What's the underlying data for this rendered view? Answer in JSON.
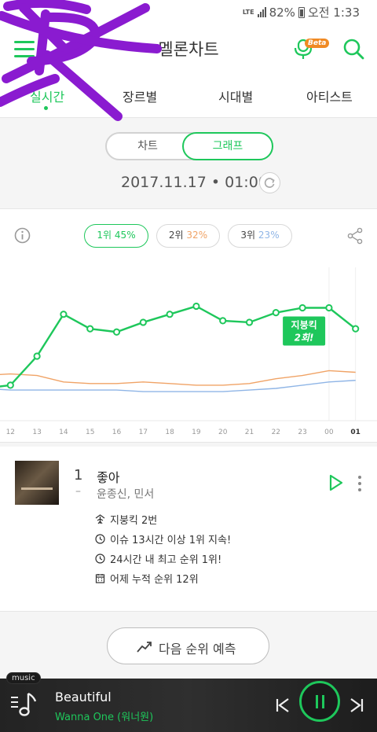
{
  "status_bar": {
    "network": "LTE",
    "battery": "82%",
    "time": "오전 1:33"
  },
  "header": {
    "title": "멜론차트",
    "beta_badge": "Beta"
  },
  "tabs": [
    {
      "label": "실시간",
      "active": true
    },
    {
      "label": "장르별",
      "active": false
    },
    {
      "label": "시대별",
      "active": false
    },
    {
      "label": "아티스트",
      "active": false
    }
  ],
  "view_toggle": {
    "chart_label": "차트",
    "graph_label": "그래프",
    "selected": "그래프"
  },
  "datetime": {
    "date": "2017.11.17",
    "separator": "•",
    "time": "01:00"
  },
  "legend": [
    {
      "rank": "1위",
      "pct": "45%",
      "color": "#1ec75b"
    },
    {
      "rank": "2위",
      "pct": "32%",
      "color": "#f0a366"
    },
    {
      "rank": "3위",
      "pct": "23%",
      "color": "#8fb5e6"
    }
  ],
  "chart_data": {
    "type": "line",
    "x": [
      "12",
      "13",
      "14",
      "15",
      "16",
      "17",
      "18",
      "19",
      "20",
      "21",
      "22",
      "23",
      "00",
      "01"
    ],
    "series": [
      {
        "values": [
          20,
          22,
          40,
          66,
          57,
          55,
          61,
          66,
          71,
          62,
          61,
          67,
          70,
          70,
          57
        ],
        "color": "#1ec75b"
      },
      {
        "values": [
          28,
          29,
          28,
          24,
          23,
          23,
          24,
          23,
          22,
          22,
          23,
          26,
          28,
          31,
          30
        ],
        "color": "#f0a366"
      },
      {
        "values": [
          20,
          19,
          19,
          19,
          19,
          19,
          18,
          18,
          18,
          18,
          19,
          20,
          22,
          24,
          25
        ],
        "color": "#8fb5e6"
      }
    ],
    "annotation": {
      "line1": "지붕킥",
      "line2": "2회!"
    },
    "ylim": [
      0,
      100
    ]
  },
  "song": {
    "rank": "1",
    "change": "–",
    "title": "좋아",
    "artist": "윤종신, 민서",
    "info": [
      {
        "icon": "rooftop-kick-icon",
        "text": "지붕킥 2번"
      },
      {
        "icon": "streak-icon",
        "text": "이슈 13시간 이상 1위 지속!"
      },
      {
        "icon": "clock-icon",
        "text": "24시간 내 최고 순위 1위!"
      },
      {
        "icon": "calendar-icon",
        "text": "어제 누적 순위 12위"
      }
    ]
  },
  "predict_button": {
    "label": "다음 순위 예측"
  },
  "player": {
    "badge": "music",
    "title": "Beautiful",
    "artist": "Wanna One (워너원)"
  },
  "colors": {
    "accent": "#1ec75b",
    "beta": "#f08a24",
    "player_bg": "#2a2a2a"
  }
}
